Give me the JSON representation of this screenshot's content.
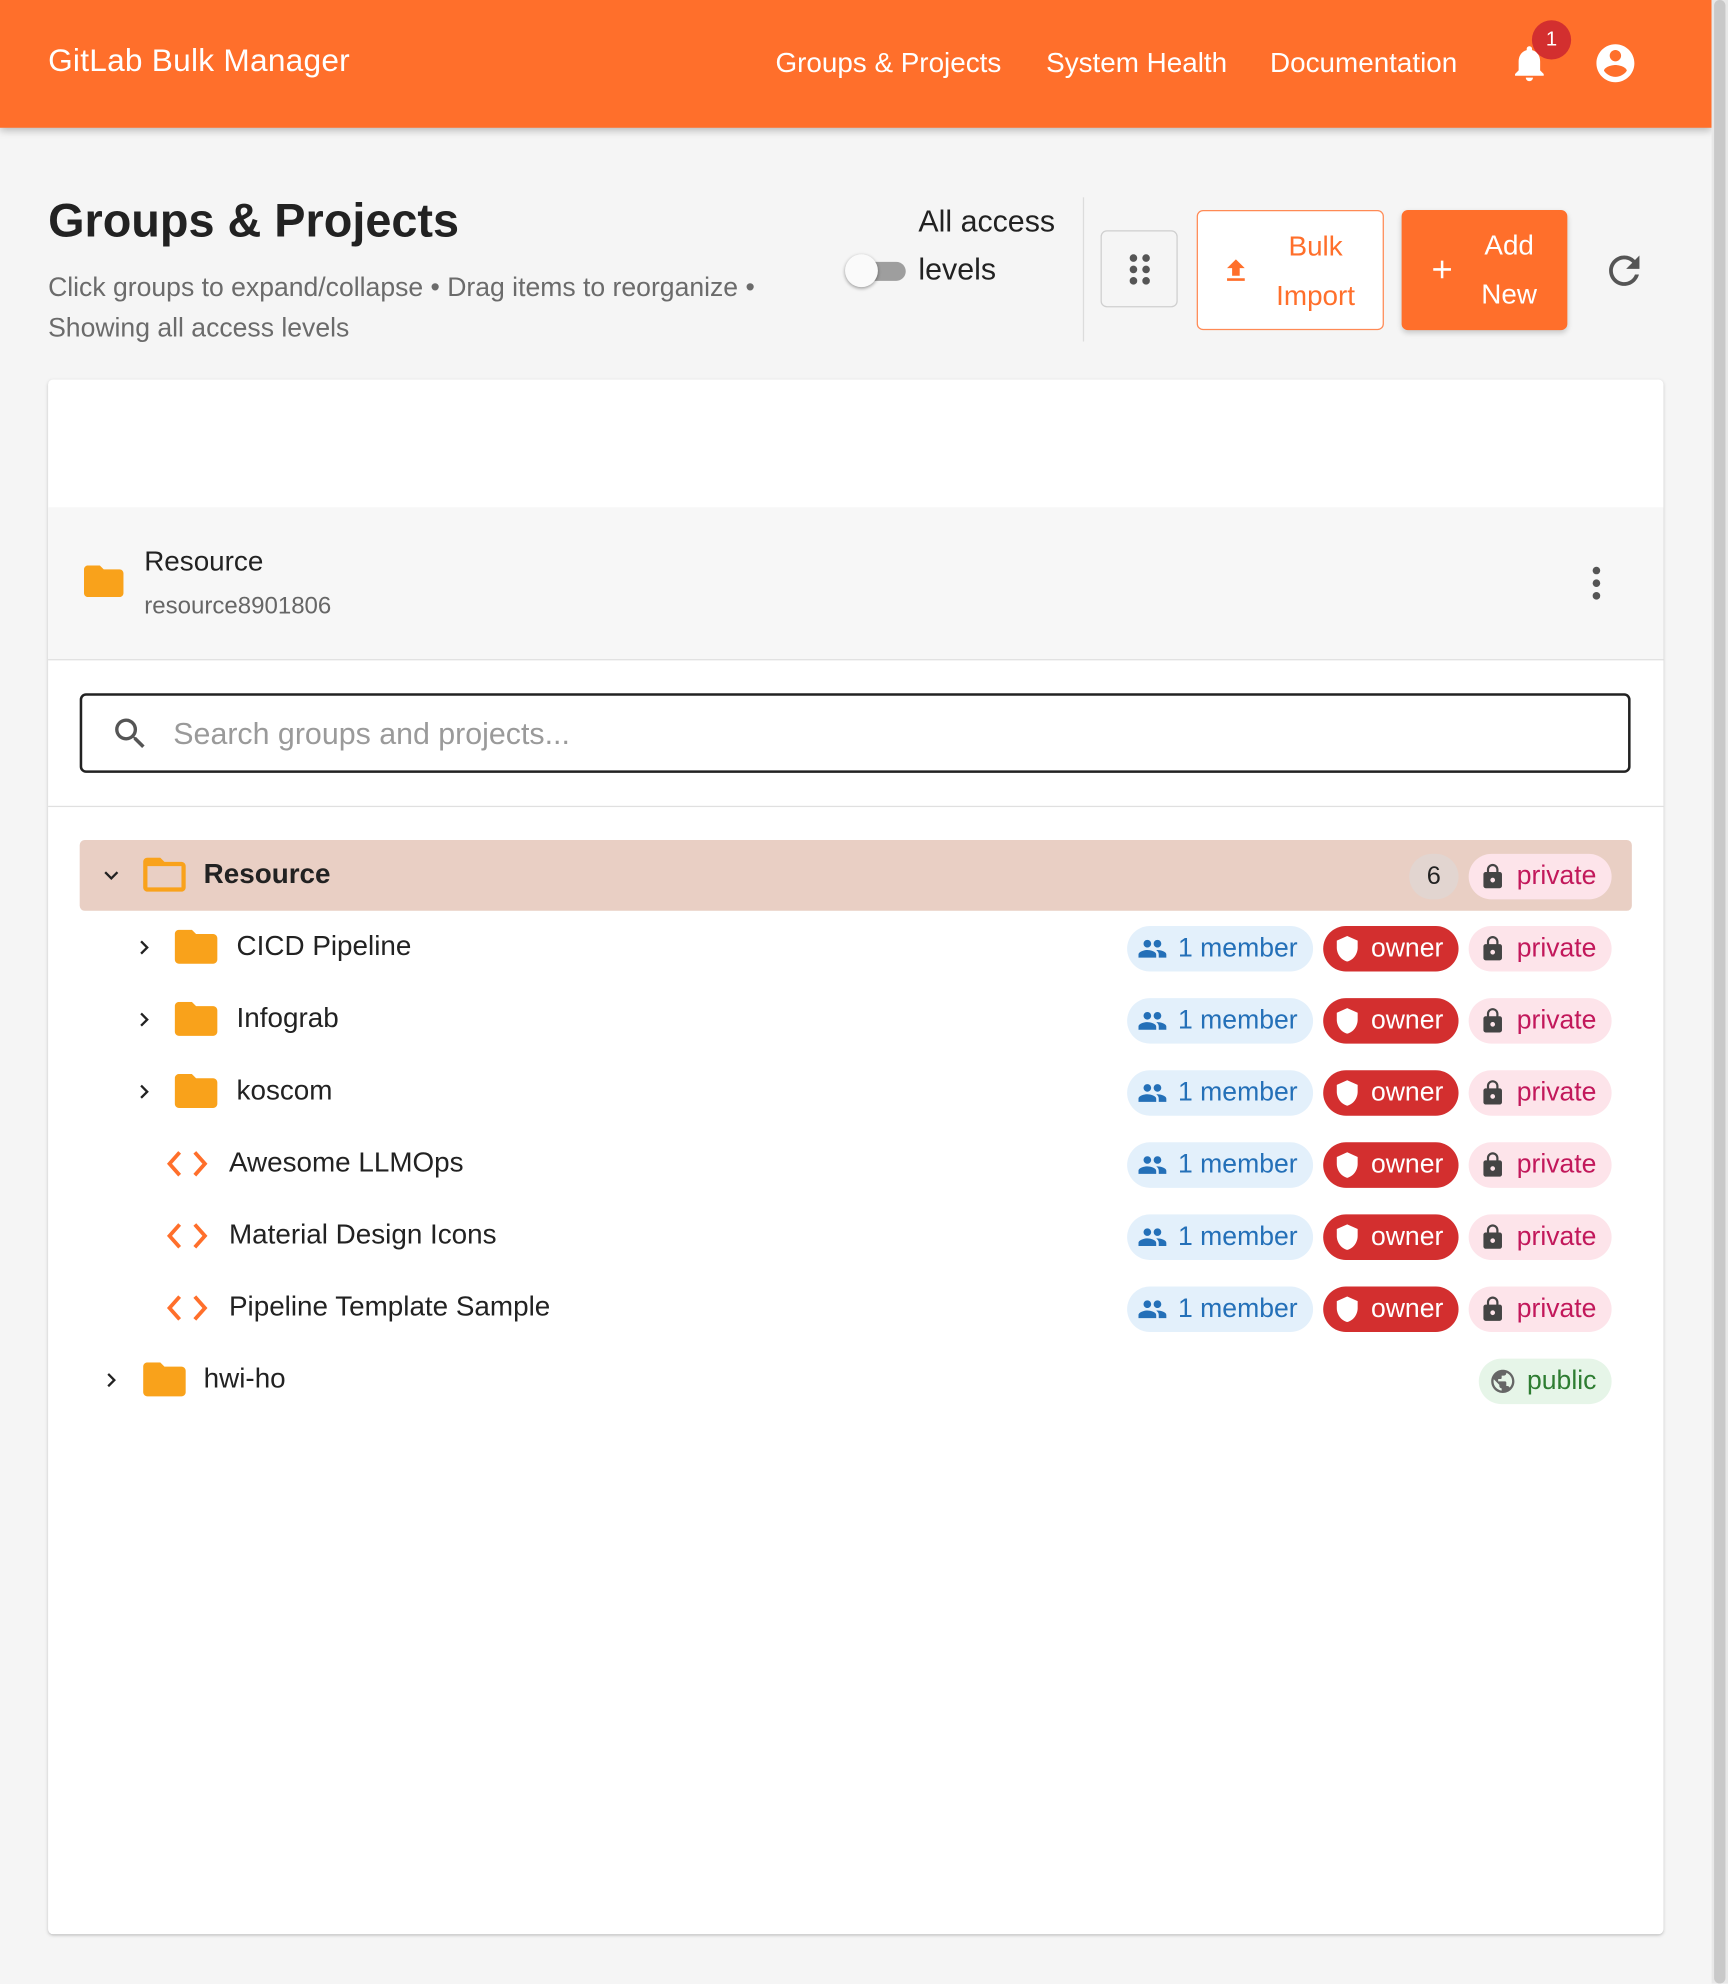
{
  "app": {
    "title": "GitLab Bulk Manager",
    "nav": [
      "Groups & Projects",
      "System Health",
      "Documentation"
    ],
    "notification_count": "1",
    "brand_color": "#ff6f2b"
  },
  "header": {
    "title": "Groups & Projects",
    "subtitle": "Click groups to expand/collapse • Drag items to reorganize • Showing all access levels",
    "toggle_label": "All access levels",
    "toggle_on": false,
    "bulk_import_label": "Bulk Import",
    "add_new_label": "Add New"
  },
  "root_group": {
    "name": "Resource",
    "path": "resource8901806"
  },
  "search": {
    "placeholder": "Search groups and projects..."
  },
  "tree": {
    "root": {
      "name": "Resource",
      "count": "6",
      "visibility": "private",
      "expanded": true
    },
    "children": [
      {
        "type": "group",
        "name": "CICD Pipeline",
        "members": "1 member",
        "role": "owner",
        "visibility": "private"
      },
      {
        "type": "group",
        "name": "Infograb",
        "members": "1 member",
        "role": "owner",
        "visibility": "private"
      },
      {
        "type": "group",
        "name": "koscom",
        "members": "1 member",
        "role": "owner",
        "visibility": "private"
      },
      {
        "type": "project",
        "name": "Awesome LLMOps",
        "members": "1 member",
        "role": "owner",
        "visibility": "private"
      },
      {
        "type": "project",
        "name": "Material Design Icons",
        "members": "1 member",
        "role": "owner",
        "visibility": "private"
      },
      {
        "type": "project",
        "name": "Pipeline Template Sample",
        "members": "1 member",
        "role": "owner",
        "visibility": "private"
      }
    ],
    "sibling": {
      "name": "hwi-ho",
      "visibility": "public"
    }
  }
}
